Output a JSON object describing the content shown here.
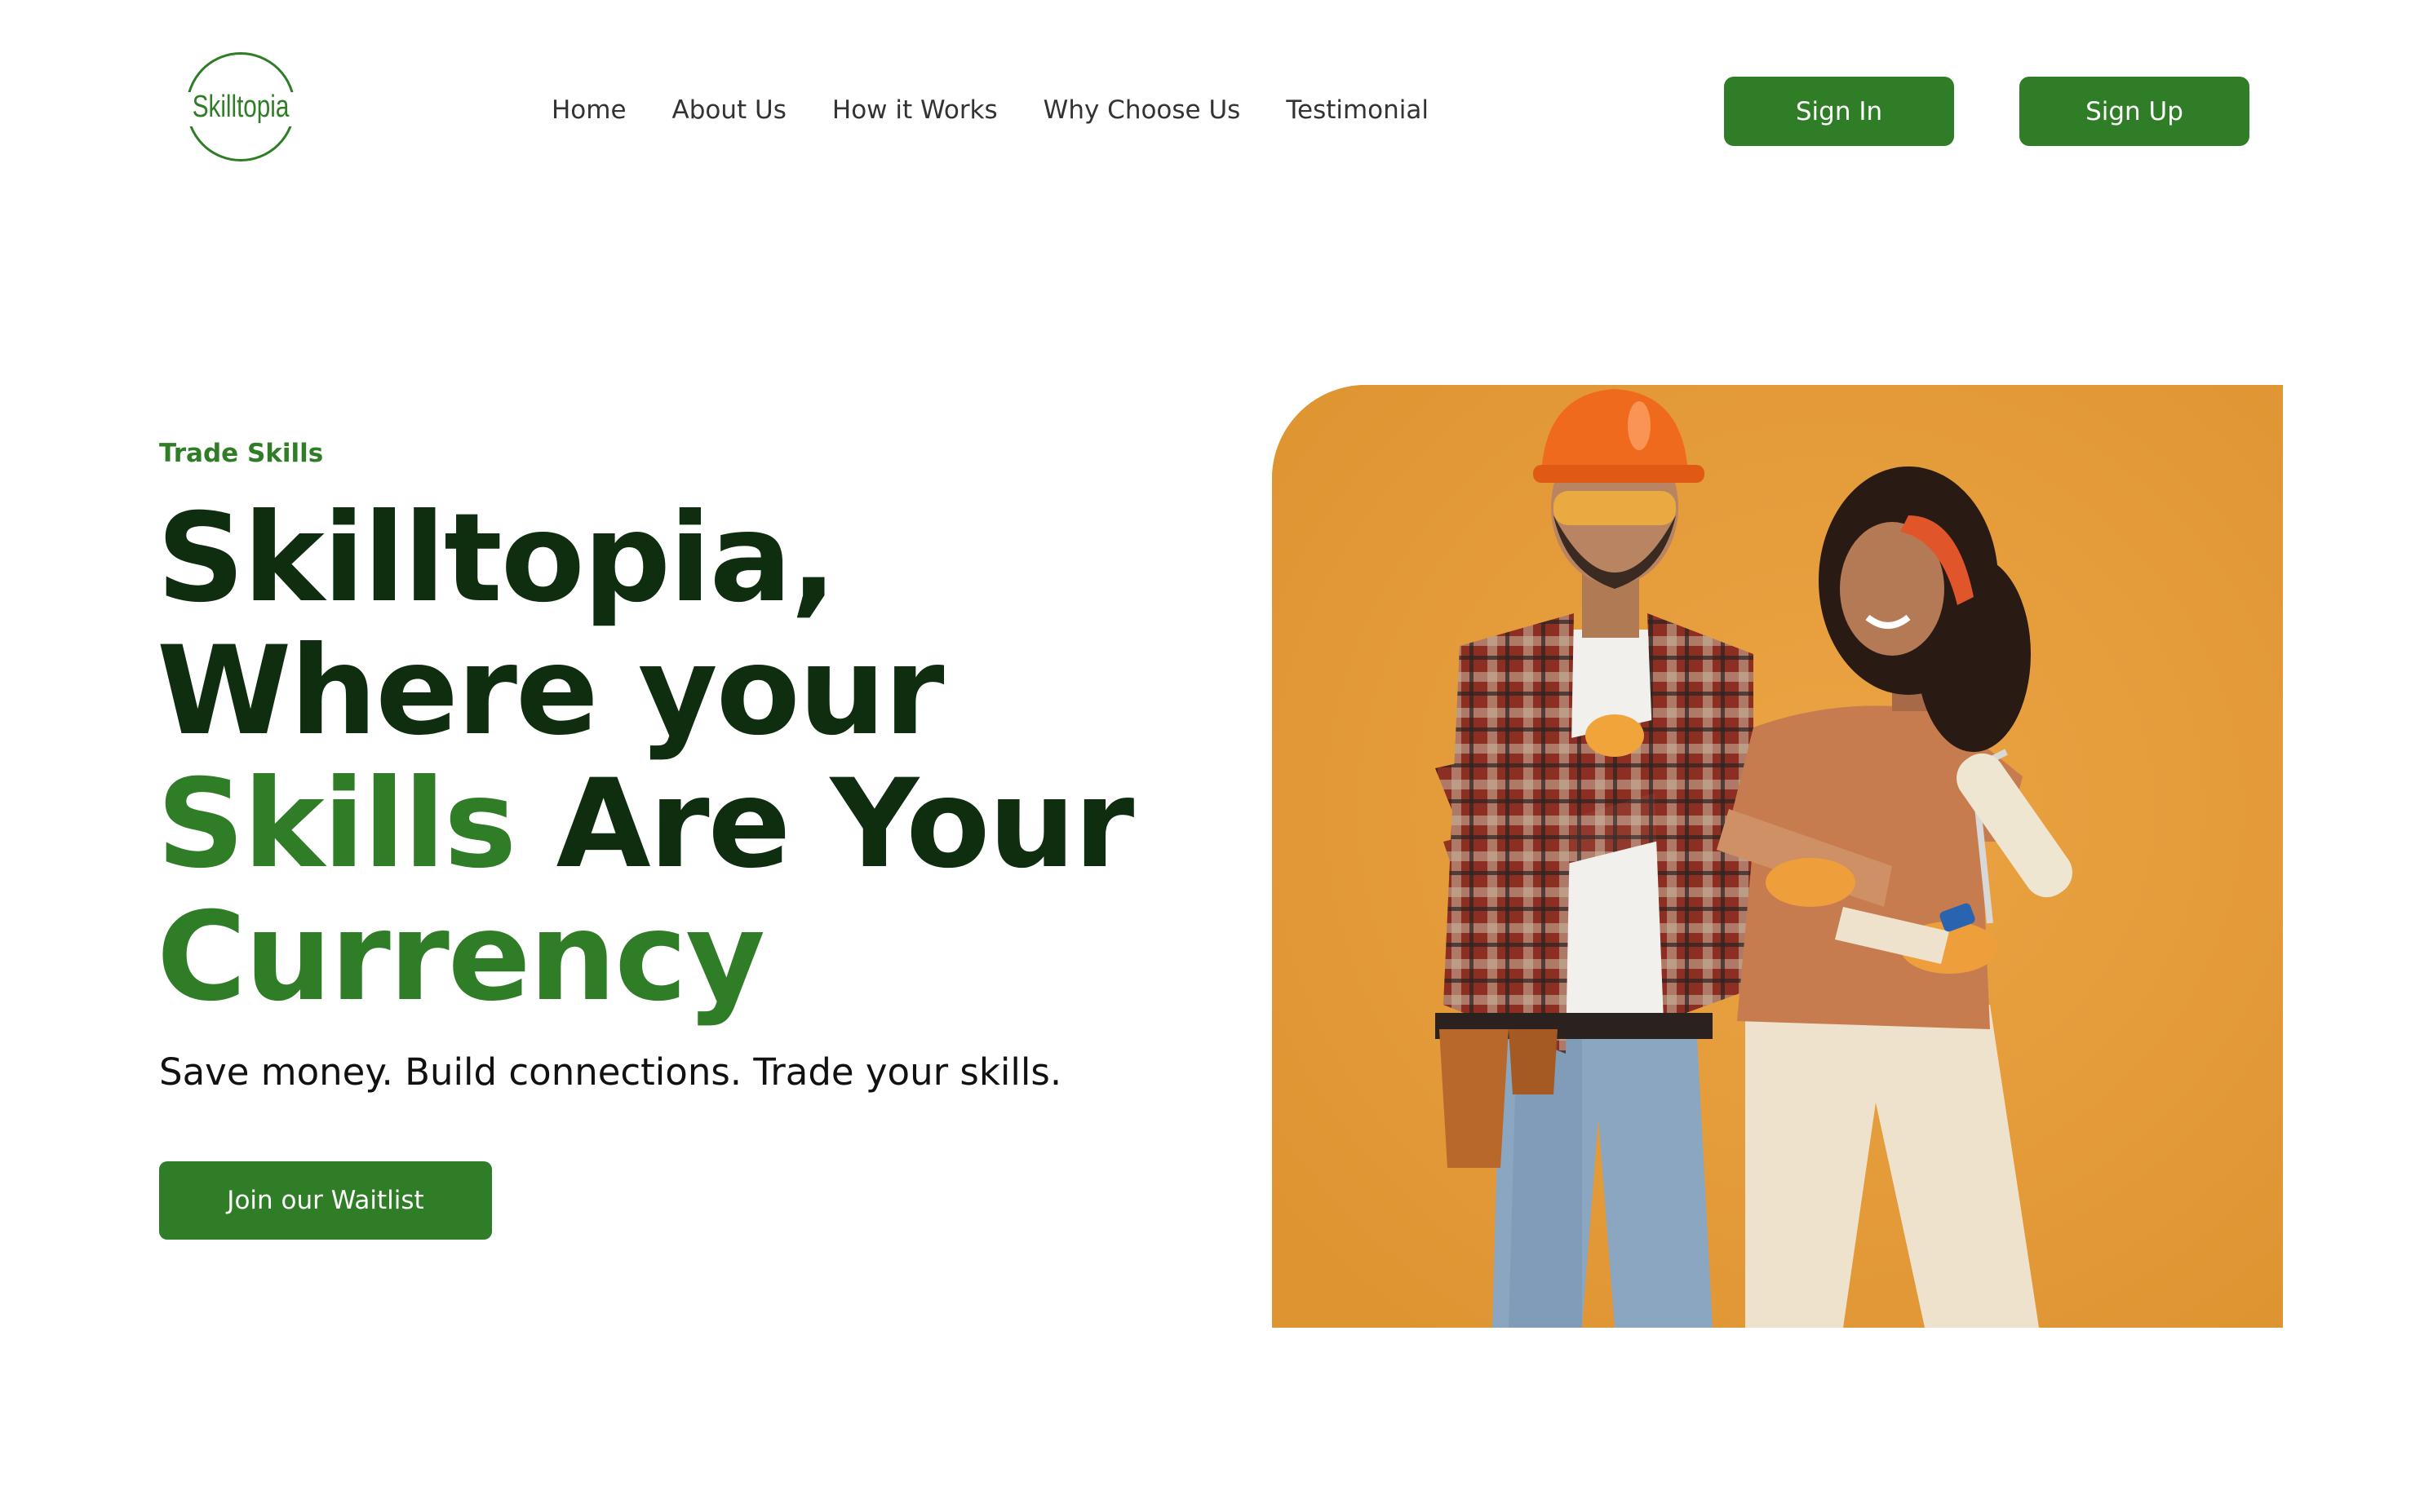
{
  "brand": {
    "logo_text": "Skilltopia",
    "brand_color": "#2f7d27",
    "dark_text_color": "#0f2e10"
  },
  "nav": {
    "items": [
      {
        "label": "Home"
      },
      {
        "label": "About Us"
      },
      {
        "label": "How it Works"
      },
      {
        "label": "Why Choose Us"
      },
      {
        "label": "Testimonial"
      }
    ]
  },
  "auth": {
    "sign_in_label": "Sign In",
    "sign_up_label": "Sign Up"
  },
  "hero": {
    "eyebrow": "Trade Skills",
    "headline": {
      "line1": "Skilltopia,",
      "line2": "Where your",
      "line3_accent": "Skills",
      "line3_rest": " Are Your",
      "line4_accent": "Currency"
    },
    "subtitle": "Save money. Build connections. Trade your skills.",
    "cta_label": "Join our Waitlist",
    "image": {
      "description_icon": "photo-two-tradespeople",
      "background_color": "#e59b39"
    }
  }
}
